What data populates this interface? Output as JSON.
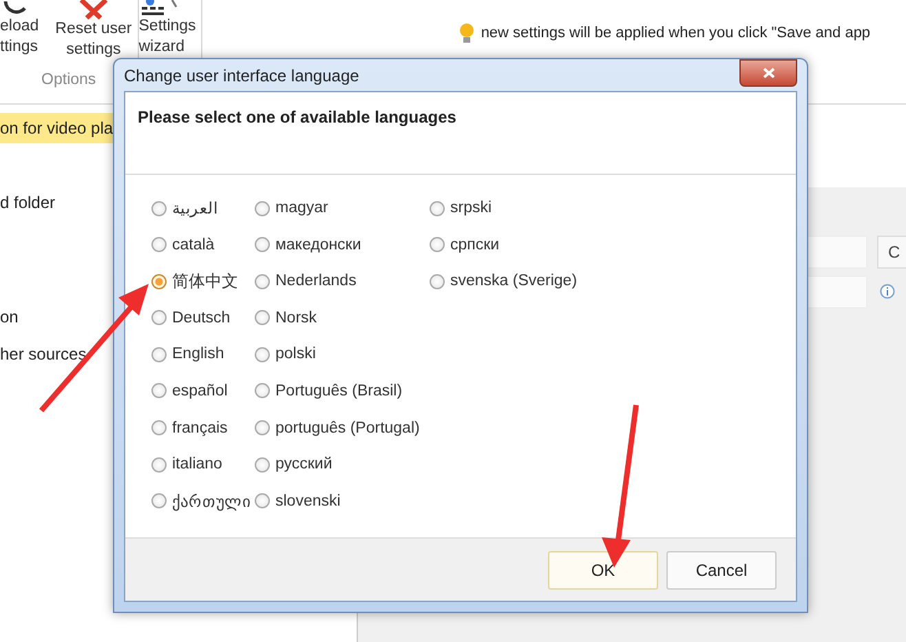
{
  "toolbar": {
    "buttons": [
      {
        "label": "eload\nttings"
      },
      {
        "label": "Reset user\nsettings"
      },
      {
        "label": "Settings\nwizard"
      }
    ],
    "group_label": "Options",
    "hint": "new settings will be applied when you click \"Save and app"
  },
  "sidebar": {
    "items": [
      {
        "label": "on for video pla",
        "selected": true
      },
      {
        "label": "d folder",
        "selected": false
      },
      {
        "label": "on",
        "selected": false
      },
      {
        "label": "her sources",
        "selected": false
      }
    ]
  },
  "panel": {
    "button": "C"
  },
  "dialog": {
    "title": "Change user interface language",
    "heading": "Please select one of available languages",
    "languages": [
      {
        "label": "العربية",
        "selected": false
      },
      {
        "label": "català",
        "selected": false
      },
      {
        "label": "简体中文",
        "selected": true
      },
      {
        "label": "Deutsch",
        "selected": false
      },
      {
        "label": "English",
        "selected": false
      },
      {
        "label": "español",
        "selected": false
      },
      {
        "label": "français",
        "selected": false
      },
      {
        "label": "italiano",
        "selected": false
      },
      {
        "label": "ქართული",
        "selected": false
      },
      {
        "label": "magyar",
        "selected": false
      },
      {
        "label": "македонски",
        "selected": false
      },
      {
        "label": "Nederlands",
        "selected": false
      },
      {
        "label": "Norsk",
        "selected": false
      },
      {
        "label": "polski",
        "selected": false
      },
      {
        "label": "Português (Brasil)",
        "selected": false
      },
      {
        "label": "português (Portugal)",
        "selected": false
      },
      {
        "label": "русский",
        "selected": false
      },
      {
        "label": "slovenski",
        "selected": false
      },
      {
        "label": "srpski",
        "selected": false
      },
      {
        "label": "српски",
        "selected": false
      },
      {
        "label": "svenska (Sverige)",
        "selected": false
      }
    ],
    "buttons": [
      {
        "label": "OK",
        "kind": "default"
      },
      {
        "label": "Cancel",
        "kind": "normal"
      }
    ]
  }
}
